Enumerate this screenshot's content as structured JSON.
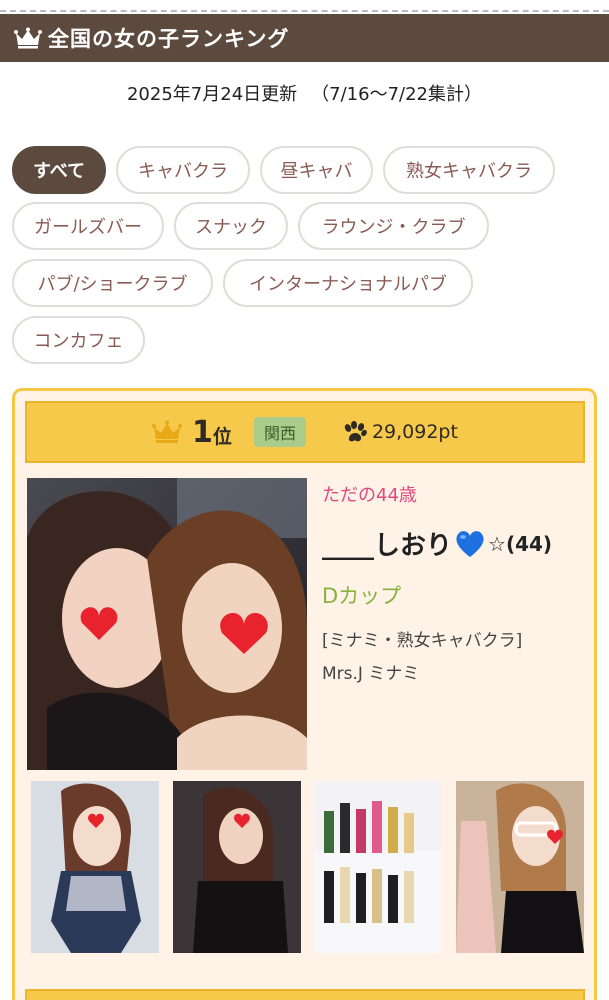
{
  "header": {
    "title": "全国の女の子ランキング",
    "icon": "crown-icon"
  },
  "update": {
    "date": "2025年7月24日更新",
    "period": "（7/16〜7/22集計）"
  },
  "categories": [
    {
      "label": "すべて",
      "active": true
    },
    {
      "label": "キャバクラ",
      "active": false
    },
    {
      "label": "昼キャバ",
      "active": false
    },
    {
      "label": "熟女キャバクラ",
      "active": false
    },
    {
      "label": "ガールズバー",
      "active": false
    },
    {
      "label": "スナック",
      "active": false
    },
    {
      "label": "ラウンジ・クラブ",
      "active": false
    },
    {
      "label": "パブ/ショークラブ",
      "active": false
    },
    {
      "label": "インターナショナルパブ",
      "active": false
    },
    {
      "label": "コンカフェ",
      "active": false
    }
  ],
  "ranking": {
    "rank_number": "1",
    "rank_unit": "位",
    "region": "関西",
    "points": "29,092pt",
    "catchphrase": "ただの44歳",
    "name": "____しおり",
    "name_suffix": "☆(44)",
    "cup": "Dカップ",
    "shop_category": "[ミナミ・熟女キャバクラ]",
    "shop_name": "Mrs.J ミナミ",
    "thumbnails": 4
  },
  "colors": {
    "header_bg": "#5c4a3e",
    "rank_bar": "#f7c94a",
    "card_bg": "#fef3e6",
    "catch_pink": "#e5487e",
    "cup_green": "#8ab03f",
    "region_green": "#a9cc8a"
  }
}
